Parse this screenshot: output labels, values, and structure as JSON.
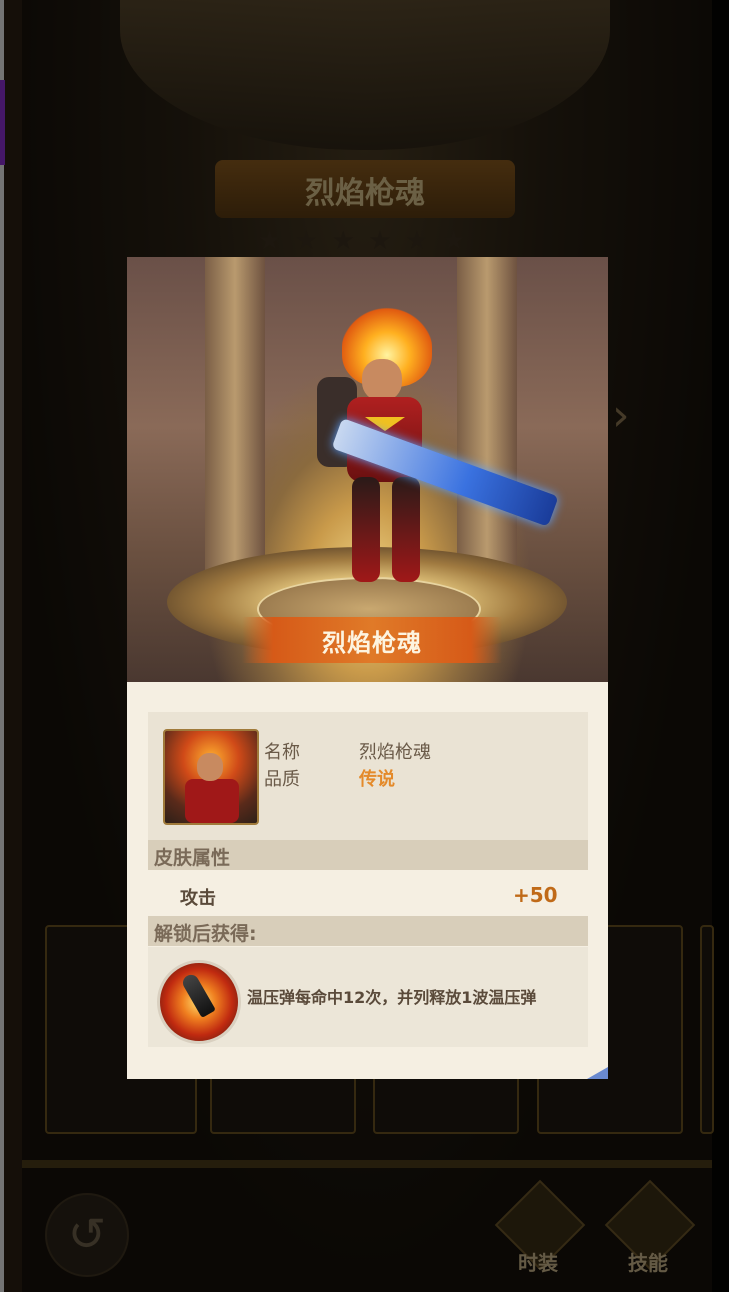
{
  "background": {
    "title": "烈焰枪魂",
    "buttons": {
      "back_icon": "undo-arrow-icon",
      "fashion_label": "时装",
      "skill_label": "技能"
    }
  },
  "modal": {
    "hero_name_banner": "烈焰枪魂",
    "info": {
      "name_label": "名称",
      "name_value": "烈焰枪魂",
      "quality_label": "品质",
      "quality_value": "传说"
    },
    "attributes": {
      "section_title": "皮肤属性",
      "rows": [
        {
          "name": "攻击",
          "value": "+50"
        }
      ]
    },
    "unlock": {
      "section_title": "解锁后获得:",
      "perk_text": "温压弹每命中12次，并列释放1波温压弹"
    }
  },
  "colors": {
    "quality_legend": "#e48a2a",
    "attribute_value": "#c06a18",
    "banner": "#d65a18"
  }
}
